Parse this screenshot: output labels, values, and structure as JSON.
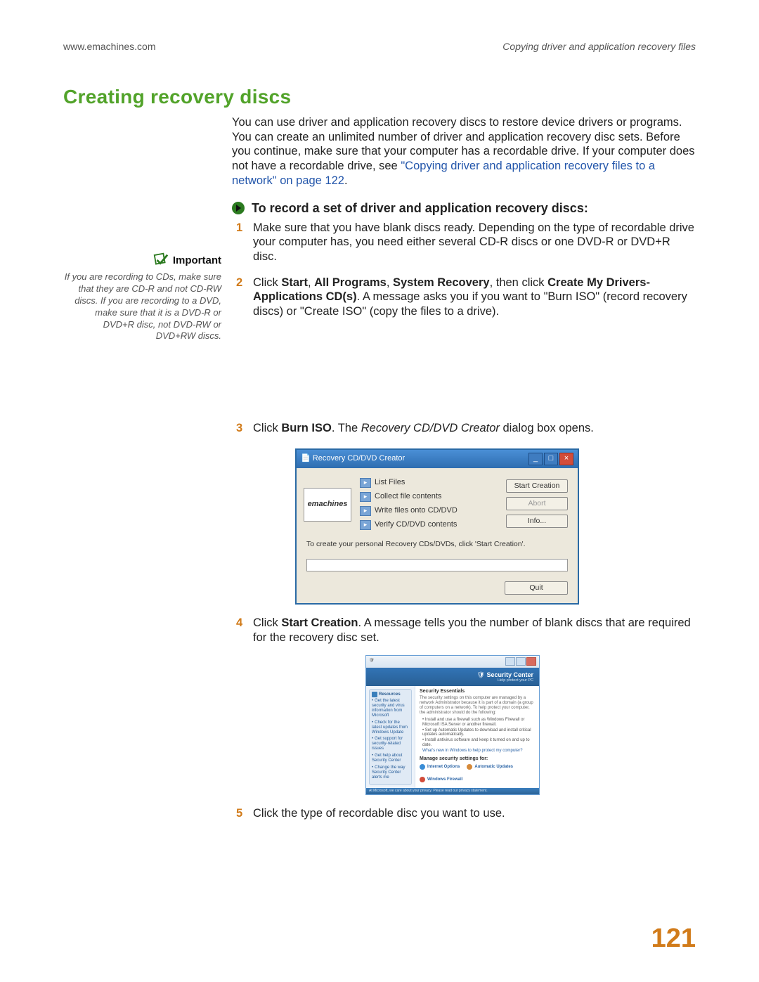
{
  "header": {
    "url": "www.emachines.com",
    "section": "Copying driver and application recovery files"
  },
  "title": "Creating recovery discs",
  "intro": {
    "text": "You can use driver and application recovery discs to restore device drivers or programs. You can create an unlimited number of driver and application recovery disc sets. Before you continue, make sure that your computer has a recordable drive. If your computer does not have a recordable drive, see ",
    "link": "\"Copying driver and application recovery files to a network\" on page 122",
    "after": "."
  },
  "instr_head": "To record a set of driver and application recovery discs:",
  "steps": {
    "n1": "1",
    "s1": "Make sure that you have blank discs ready. Depending on the type of recordable drive your computer has, you need either several CD-R discs or one DVD-R or DVD+R disc.",
    "n2": "2",
    "s2a": "Click ",
    "s2_start": "Start",
    "s2b": ", ",
    "s2_all": "All Programs",
    "s2c": ", ",
    "s2_sys": "System Recovery",
    "s2d": ", then click ",
    "s2_create": "Create My Drivers-Applications CD(s)",
    "s2e": ". A message asks you if you want to \"Burn ISO\" (record recovery discs) or \"Create ISO\" (copy the files to a drive).",
    "n3": "3",
    "s3a": "Click ",
    "s3_burn": "Burn ISO",
    "s3b": ". The ",
    "s3_italic": "Recovery CD/DVD Creator",
    "s3c": " dialog box opens.",
    "n4": "4",
    "s4a": "Click ",
    "s4_sc": "Start Creation",
    "s4b": ". A message tells you the number of blank discs that are required for the recovery disc set.",
    "n5": "5",
    "s5": "Click the type of recordable disc you want to use."
  },
  "important": {
    "label": "Important",
    "text": "If you are recording to CDs, make sure that they are CD-R and not CD-RW discs. If you are recording to a DVD, make sure that it is a DVD-R or DVD+R disc, not DVD-RW or DVD+RW discs."
  },
  "dlg1": {
    "title": "Recovery CD/DVD Creator",
    "logo": "emachines",
    "step1": "List Files",
    "step2": "Collect file contents",
    "step3": "Write files onto CD/DVD",
    "step4": "Verify CD/DVD contents",
    "btn_start": "Start Creation",
    "btn_abort": "Abort",
    "btn_info": "Info...",
    "msg": "To create your personal Recovery CDs/DVDs, click 'Start Creation'.",
    "btn_quit": "Quit"
  },
  "dlg2": {
    "banner_title": "Security Center",
    "banner_sub": "Help protect your PC",
    "side_head": "Resources",
    "side_l1": "Get the latest security and virus information from Microsoft",
    "side_l2": "Check for the latest updates from Windows Update",
    "side_l3": "Get support for security-related issues",
    "side_l4": "Get help about Security Center",
    "side_l5": "Change the way Security Center alerts me",
    "main_head": "Security Essentials",
    "main_blurb": "The security settings on this computer are managed by a network Administrator because it is part of a domain (a group of computers on a network). To help protect your computer, the administrator should do the following:",
    "b1": "Install and use a firewall such as Windows Firewall or Microsoft ISA Server or another firewall.",
    "b2": "Set up Automatic Updates to download and install critical updates automatically.",
    "b3": "Install antivirus software and keep it turned on and up to date.",
    "link_after": "What's new in Windows to help protect my computer?",
    "ms_head": "Manage security settings for:",
    "ms_l1": "Internet Options",
    "ms_l2": "Automatic Updates",
    "ms_l3": "Windows Firewall",
    "footer": "At Microsoft, we care about your privacy. Please read our privacy statement."
  },
  "pagenum": "121"
}
